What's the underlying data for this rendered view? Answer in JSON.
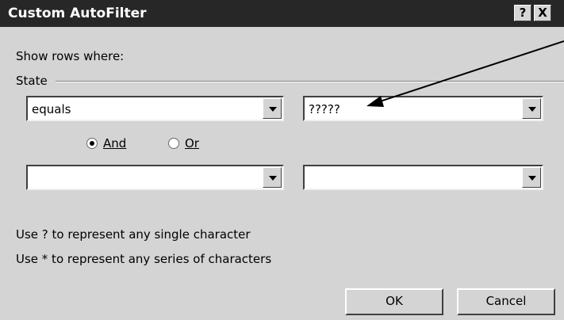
{
  "window": {
    "title": "Custom AutoFilter",
    "help_label": "?",
    "close_label": "X"
  },
  "dialog": {
    "show_rows_label": "Show rows where:",
    "field_label": "State",
    "row1": {
      "operator": "equals",
      "value": "?????"
    },
    "logic": {
      "and_label": "And",
      "or_label": "Or",
      "selected": "And"
    },
    "row2": {
      "operator": "",
      "value": ""
    },
    "hint1": "Use ? to represent any single character",
    "hint2": "Use * to represent any series of characters",
    "ok_label": "OK",
    "cancel_label": "Cancel"
  }
}
